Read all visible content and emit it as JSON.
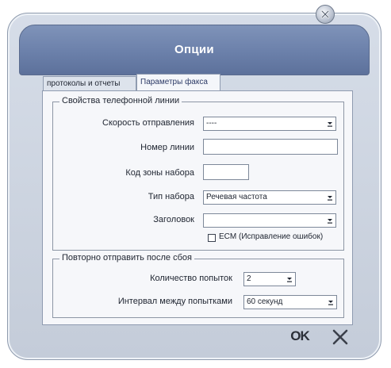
{
  "dialog": {
    "title": "Опции"
  },
  "tabs": [
    {
      "label": "протоколы и отчеты"
    },
    {
      "label": "Параметры факса",
      "active": true
    }
  ],
  "phone_line": {
    "legend": "Свойства телефонной линии",
    "send_speed_label": "Скорость отправления",
    "send_speed_value": "----",
    "line_number_label": "Номер линии",
    "line_number_value": "",
    "area_code_label": "Код зоны набора",
    "area_code_value": "",
    "dial_type_label": "Тип набора",
    "dial_type_value": "Речевая частота",
    "header_label": "Заголовок",
    "header_value": "",
    "ecm_label": "ECM (Исправление ошибок)",
    "ecm_checked": false
  },
  "retry": {
    "legend": "Повторно отправить после сбоя",
    "attempts_label": "Количество попыток",
    "attempts_value": "2",
    "interval_label": "Интервал между попытками",
    "interval_value": "60 секунд"
  },
  "buttons": {
    "ok_label": "OK"
  },
  "icons": {
    "close": "close-icon",
    "cancel": "x-icon",
    "dropdown": "chevron-down-icon"
  },
  "colors": {
    "header": "#6b80aa",
    "dialog_bg": "#d6dde8",
    "panel_bg": "#f6f7fa"
  }
}
